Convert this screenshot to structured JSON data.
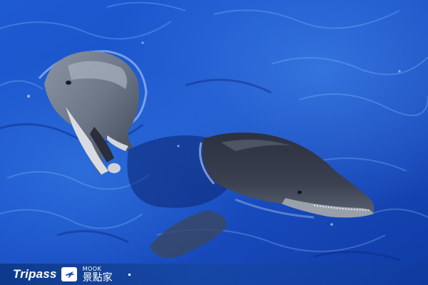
{
  "scene": {
    "description_icons": [
      "dolphin-left",
      "dolphin-right"
    ],
    "colors": {
      "water_deep": "#0a2f8f",
      "water_mid": "#1f5fd6",
      "water_light": "#5aa0f0",
      "dolphin_dark": "#2a2d3a",
      "dolphin_gray": "#7d8796",
      "dolphin_light": "#d9dbe0"
    }
  },
  "watermark": {
    "brand": "Tripass",
    "plane_icon": "airplane-icon",
    "mook_small": "MOOK",
    "mook_big": "景點家"
  }
}
